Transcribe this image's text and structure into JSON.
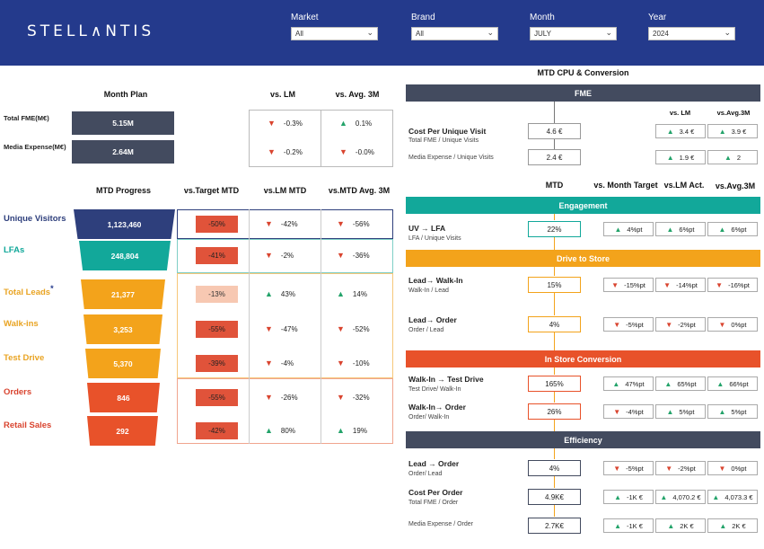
{
  "header": {
    "logo": "STELL∧NTIS",
    "filters": [
      {
        "label": "Market",
        "value": "All"
      },
      {
        "label": "Brand",
        "value": "All"
      },
      {
        "label": "Month",
        "value": "JULY"
      },
      {
        "label": "Year",
        "value": "2024"
      }
    ]
  },
  "plan": {
    "title": "Month Plan",
    "col_lm": "vs. LM",
    "col_avg": "vs. Avg. 3M",
    "rows": [
      {
        "label": "Total FME(M€)",
        "value": "5.15M",
        "lm": "-0.3%",
        "lm_dir": "down",
        "avg": "0.1%",
        "avg_dir": "up"
      },
      {
        "label": "Media Expense(M€)",
        "value": "2.64M",
        "lm": "-0.2%",
        "lm_dir": "down",
        "avg": "-0.0%",
        "avg_dir": "down"
      }
    ]
  },
  "progress": {
    "title": "MTD Progress",
    "col_target": "vs.Target MTD",
    "col_lm": "vs.LM MTD",
    "col_avg": "vs.MTD Avg. 3M",
    "rows": [
      {
        "label": "Unique Visitors",
        "value": "1,123,460",
        "target": "-50%",
        "lm": "-42%",
        "lm_dir": "down",
        "avg": "-56%",
        "avg_dir": "down"
      },
      {
        "label": "LFAs",
        "value": "248,804",
        "target": "-41%",
        "lm": "-2%",
        "lm_dir": "down",
        "avg": "-36%",
        "avg_dir": "down"
      },
      {
        "label": "Total Leads",
        "star": "*",
        "value": "21,377",
        "target": "-13%",
        "lm": "43%",
        "lm_dir": "up",
        "avg": "14%",
        "avg_dir": "up"
      },
      {
        "label": "Walk-ins",
        "value": "3,253",
        "target": "-55%",
        "lm": "-47%",
        "lm_dir": "down",
        "avg": "-52%",
        "avg_dir": "down"
      },
      {
        "label": "Test Drive",
        "value": "5,370",
        "target": "-39%",
        "lm": "-4%",
        "lm_dir": "down",
        "avg": "-10%",
        "avg_dir": "down"
      },
      {
        "label": "Orders",
        "value": "846",
        "target": "-55%",
        "lm": "-26%",
        "lm_dir": "down",
        "avg": "-32%",
        "avg_dir": "down"
      },
      {
        "label": "Retail Sales",
        "value": "292",
        "target": "-42%",
        "lm": "80%",
        "lm_dir": "up",
        "avg": "19%",
        "avg_dir": "up"
      }
    ]
  },
  "cpu": {
    "title": "MTD CPU & Conversion",
    "fme_band": "FME",
    "col_lm": "vs. LM",
    "col_avg": "vs.Avg.3M",
    "fme_rows": [
      {
        "label": "Cost Per Unique Visit",
        "sub": "Total FME / Unique Visits",
        "value": "4.6 €",
        "lm": "3.4 €",
        "lm_dir": "up",
        "avg": "3.9 €",
        "avg_dir": "up"
      },
      {
        "label": "",
        "sub": "Media Expense / Unique Visits",
        "value": "2.4 €",
        "lm": "1.9 €",
        "lm_dir": "up",
        "avg": "2",
        "avg_dir": "up"
      }
    ],
    "col_mtd": "MTD",
    "col_target": "vs. Month Target",
    "col_lmact": "vs.LM Act.",
    "col_avg3": "vs.Avg.3M",
    "sections": [
      {
        "band": "Engagement",
        "color": "#12a89a",
        "rows": [
          {
            "label": "UV → LFA",
            "sub": "LFA / Unique Visits",
            "value": "22%",
            "t": "4%pt",
            "t_dir": "up",
            "l": "6%pt",
            "l_dir": "up",
            "a": "6%pt",
            "a_dir": "up"
          }
        ]
      },
      {
        "band": "Drive to Store",
        "color": "#f3a31b",
        "rows": [
          {
            "label": "Lead→ Walk-In",
            "sub": "Walk-In / Lead",
            "value": "15%",
            "t": "-15%pt",
            "t_dir": "down",
            "l": "-14%pt",
            "l_dir": "down",
            "a": "-16%pt",
            "a_dir": "down"
          },
          {
            "label": "Lead→ Order",
            "sub": "Order / Lead",
            "value": "4%",
            "t": "-5%pt",
            "t_dir": "down",
            "l": "-2%pt",
            "l_dir": "down",
            "a": "0%pt",
            "a_dir": "down"
          }
        ]
      },
      {
        "band": "In Store Conversion",
        "color": "#e8522a",
        "rows": [
          {
            "label": "Walk-In → Test Drive",
            "sub": "Test Drive/ Walk-In",
            "value": "165%",
            "t": "47%pt",
            "t_dir": "up",
            "l": "65%pt",
            "l_dir": "up",
            "a": "66%pt",
            "a_dir": "up"
          },
          {
            "label": "Walk-In→ Order",
            "sub": "Order/ Walk-In",
            "value": "26%",
            "t": "-4%pt",
            "t_dir": "down",
            "l": "5%pt",
            "l_dir": "up",
            "a": "5%pt",
            "a_dir": "up"
          }
        ]
      },
      {
        "band": "Efficiency",
        "color": "#434b5f",
        "rows": [
          {
            "label": "Lead → Order",
            "sub": "Order/ Lead",
            "value": "4%",
            "t": "-5%pt",
            "t_dir": "down",
            "l": "-2%pt",
            "l_dir": "down",
            "a": "0%pt",
            "a_dir": "down"
          },
          {
            "label": "Cost Per Order",
            "sub": "Total FME / Order",
            "value": "4.9K€",
            "t": "-1K €",
            "t_dir": "up",
            "l": "4,070.2 €",
            "l_dir": "up",
            "a": "4,073.3 €",
            "a_dir": "up"
          },
          {
            "label": "",
            "sub": "Media Expense / Order",
            "value": "2.7K€",
            "t": "-1K €",
            "t_dir": "up",
            "l": "2K €",
            "l_dir": "up",
            "a": "2K €",
            "a_dir": "up"
          }
        ]
      }
    ]
  },
  "colors": {
    "header": "#243a8c",
    "navy": "#243a7a",
    "teal": "#12a89a",
    "amber": "#f3a31b",
    "orange": "#e8522a",
    "dark": "#434b5f",
    "red": "#d9442f",
    "green": "#23a36a"
  }
}
